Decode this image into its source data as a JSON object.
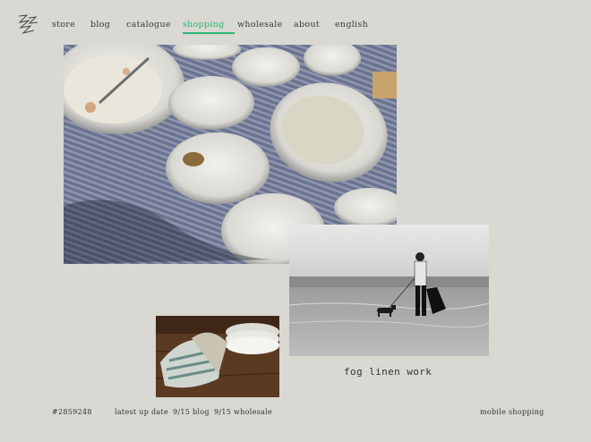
{
  "nav": {
    "items": [
      {
        "label": "store"
      },
      {
        "label": "blog"
      },
      {
        "label": "catalogue"
      },
      {
        "label": "shopping"
      },
      {
        "label": "wholesale"
      },
      {
        "label": "about"
      },
      {
        "label": "english"
      }
    ],
    "active_color": "#2bb673"
  },
  "brand": "fog linen work",
  "footer": {
    "counter": "#2859248",
    "latest_label": "latest up date",
    "blog_link": "9/15 blog",
    "wholesale_link": "9/15 wholesale",
    "mobile_link": "mobile shopping"
  },
  "colors": {
    "background": "#d9d8d3",
    "accent": "#2bb673"
  }
}
